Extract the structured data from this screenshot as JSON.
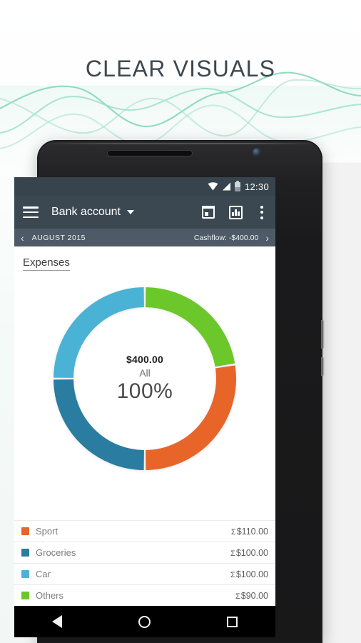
{
  "headline": "CLEAR VISUALS",
  "status_bar": {
    "time": "12:30",
    "icons": [
      "wifi-icon",
      "signal-icon",
      "battery-icon"
    ]
  },
  "toolbar": {
    "menu_icon": "hamburger-menu-icon",
    "title": "Bank account",
    "dropdown_icon": "chevron-down-icon",
    "calendar_icon": "calendar-icon",
    "chart_icon": "bar-chart-icon",
    "overflow_icon": "more-vertical-icon"
  },
  "period_bar": {
    "prev_label": "‹",
    "month": "AUGUST 2015",
    "cashflow": "Cashflow: -$400.00",
    "next_label": "›"
  },
  "section": {
    "title": "Expenses"
  },
  "donut_center": {
    "amount": "$400.00",
    "label": "All",
    "percent": "100%"
  },
  "navigation_bar": {
    "back": "back-icon",
    "home": "home-icon",
    "recents": "recents-icon"
  },
  "colors": {
    "toolbar": "#3b4852",
    "status_bar": "#37444e",
    "period_bar": "#4e5b66",
    "sport": "#e8652a",
    "groceries": "#2a7ca0",
    "car": "#4ab3d5",
    "others": "#6cc72b",
    "headline": "#3c4750",
    "wave": "#8fd8c0"
  },
  "chart_data": {
    "type": "pie",
    "title": "Expenses",
    "subtitle": "All",
    "total": 400.0,
    "total_label": "$400.00",
    "percent_label": "100%",
    "currency": "$",
    "donut": true,
    "inner_radius_ratio": 0.78,
    "start_angle_deg": -90,
    "direction": "clockwise",
    "categories": [
      "Others",
      "Sport",
      "Groceries",
      "Car"
    ],
    "values": [
      90.0,
      110.0,
      100.0,
      100.0
    ],
    "percentages": [
      22.5,
      27.5,
      25.0,
      25.0
    ],
    "slice_colors": [
      "#6cc72b",
      "#e8652a",
      "#2a7ca0",
      "#4ab3d5"
    ],
    "legend_position": "bottom",
    "legend": [
      {
        "name": "Sport",
        "color": "#e8652a",
        "sigma": "Σ",
        "value": "$110.00",
        "amount": 110.0
      },
      {
        "name": "Groceries",
        "color": "#2a7ca0",
        "sigma": "Σ",
        "value": "$100.00",
        "amount": 100.0
      },
      {
        "name": "Car",
        "color": "#4ab3d5",
        "sigma": "Σ",
        "value": "$100.00",
        "amount": 100.0
      },
      {
        "name": "Others",
        "color": "#6cc72b",
        "sigma": "Σ",
        "value": "$90.00",
        "amount": 90.0
      }
    ]
  }
}
